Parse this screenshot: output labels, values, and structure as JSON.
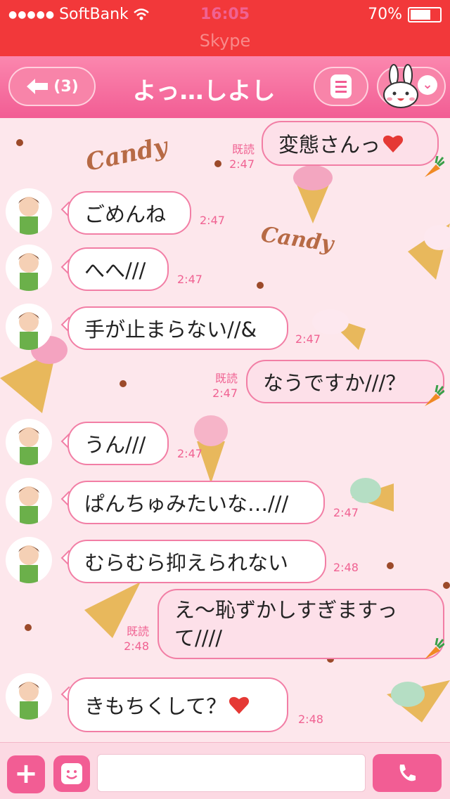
{
  "status_bar": {
    "carrier": "SoftBank",
    "time": "16:05",
    "battery": "70%",
    "battery_level": 0.7,
    "app_hint": "Skype"
  },
  "header": {
    "back_label": "(3)",
    "title": "よっ…しよし"
  },
  "messages": [
    {
      "dir": "out",
      "text": "変態さんっ",
      "heart": true,
      "read": "既読",
      "time": "2:47"
    },
    {
      "dir": "in",
      "text": "ごめんね",
      "time": "2:47"
    },
    {
      "dir": "in",
      "text": "へへ///",
      "time": "2:47"
    },
    {
      "dir": "in",
      "text": "手が止まらない//&",
      "time": "2:47"
    },
    {
      "dir": "out",
      "text": "なうですか///？",
      "read": "既読",
      "time": "2:47"
    },
    {
      "dir": "in",
      "text": "うん///",
      "time": "2:47"
    },
    {
      "dir": "in",
      "text": "ぱんちゅみたいな…///",
      "time": "2:47"
    },
    {
      "dir": "in",
      "text": "むらむら抑えられない",
      "time": "2:48"
    },
    {
      "dir": "out",
      "text_line1": "え〜恥ずかしすぎますっ",
      "text_line2": "て////",
      "read": "既読",
      "time": "2:48"
    },
    {
      "dir": "in",
      "text": "きもちくして？",
      "heart": true,
      "time": "2:48"
    }
  ],
  "background_text": [
    "Candy",
    "Candy"
  ],
  "colors": {
    "status": "#f2383a",
    "nav": "#f25d94",
    "bubble_border": "#f27ea5",
    "time": "#f06292"
  }
}
